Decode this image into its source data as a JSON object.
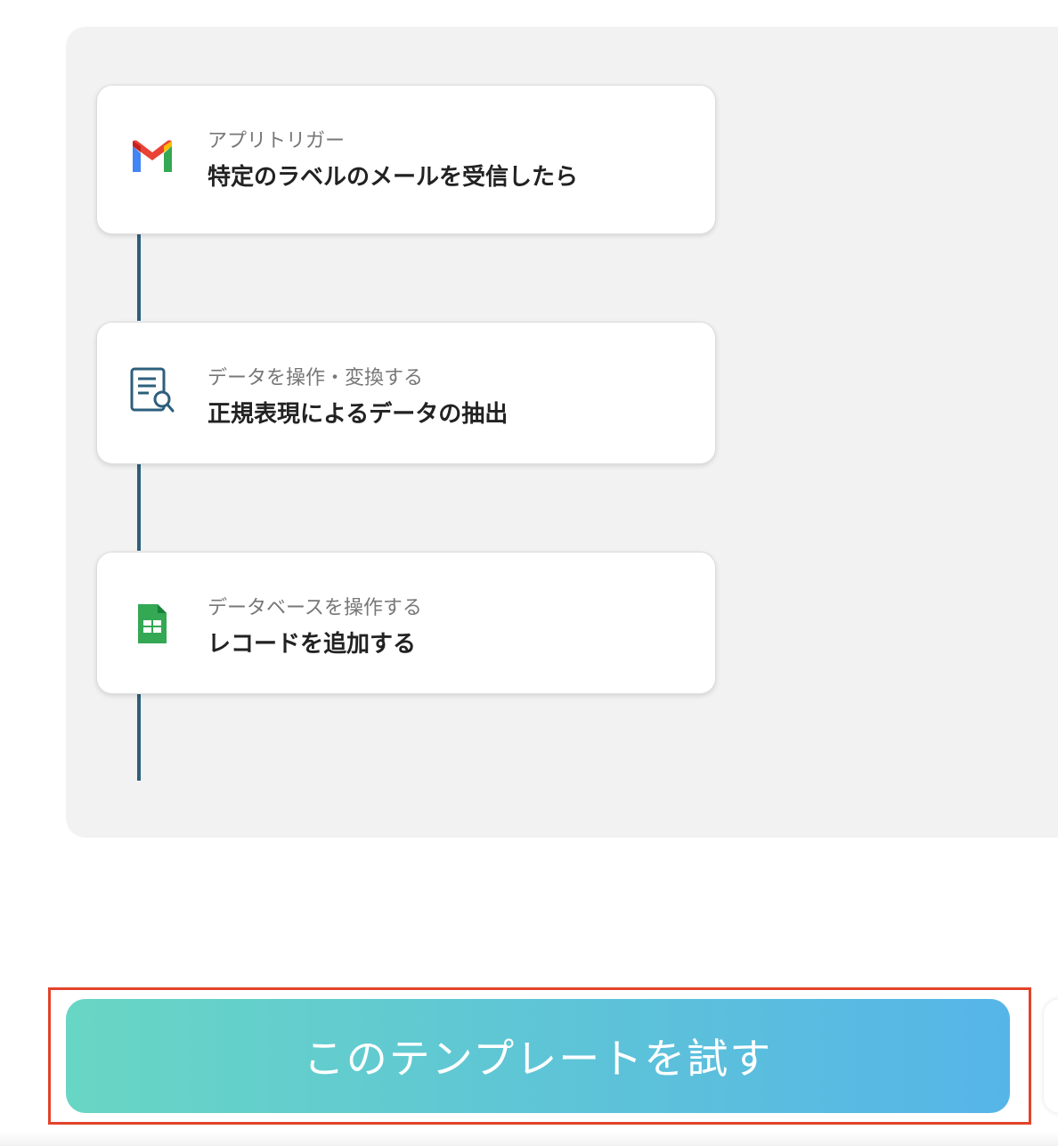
{
  "steps": [
    {
      "icon": "gmail-icon",
      "subtitle": "アプリトリガー",
      "title": "特定のラベルのメールを受信したら"
    },
    {
      "icon": "document-search-icon",
      "subtitle": "データを操作・変換する",
      "title": "正規表現によるデータの抽出"
    },
    {
      "icon": "google-sheets-icon",
      "subtitle": "データベースを操作する",
      "title": "レコードを追加する"
    }
  ],
  "cta": {
    "label": "このテンプレートを試す"
  },
  "colors": {
    "connector": "#2c5f7c",
    "panel_bg": "#f2f2f2",
    "cta_gradient_start": "#68d6c4",
    "cta_gradient_end": "#56b5e8",
    "highlight_border": "#e2432a"
  }
}
